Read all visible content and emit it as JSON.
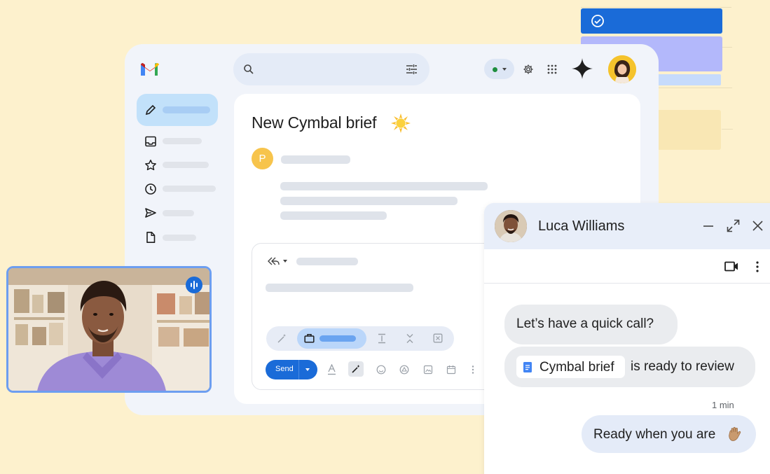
{
  "colors": {
    "background": "#fdf1cd",
    "accent": "#1a6bd8",
    "window": "#f1f4fa",
    "chat_header": "#e8eef9",
    "status_online": "#1e8e3e"
  },
  "calendar": {
    "check_icon": "check-circle-icon"
  },
  "gmail": {
    "logo": "gmail-logo",
    "search": {
      "icon": "search-icon",
      "filter_icon": "tune-icon"
    },
    "header": {
      "status_icon": "status-dot-icon",
      "settings_icon": "gear-icon",
      "apps_icon": "apps-grid-icon",
      "gemini_icon": "gemini-sparkle-icon"
    },
    "sidebar": {
      "compose_icon": "pencil-icon",
      "items": [
        {
          "icon": "inbox-icon"
        },
        {
          "icon": "star-icon"
        },
        {
          "icon": "clock-icon"
        },
        {
          "icon": "send-icon"
        },
        {
          "icon": "draft-icon"
        }
      ]
    },
    "message": {
      "subject": "New Cymbal brief",
      "subject_emoji": "sun-emoji",
      "sender_initial": "P"
    },
    "reply": {
      "send_label": "Send",
      "toolbar_icons": [
        "text-format-icon",
        "magic-write-icon",
        "emoji-icon",
        "drive-icon",
        "image-icon",
        "schedule-icon",
        "more-vert-icon"
      ]
    }
  },
  "video": {
    "speaking_icon": "audio-wave-icon"
  },
  "chat": {
    "contact_name": "Luca Williams",
    "header_icons": [
      "minimize-icon",
      "expand-icon",
      "close-icon"
    ],
    "toolbar_icons": [
      "video-call-icon",
      "more-vert-icon"
    ],
    "messages": [
      {
        "text": "Let’s have a quick call?"
      },
      {
        "chip_label": "Cymbal brief",
        "chip_icon": "google-docs-icon",
        "text": "is ready to review"
      }
    ],
    "timestamp": "1 min",
    "my_message": {
      "text": "Ready when you are",
      "emoji": "waving-hand-emoji"
    }
  }
}
